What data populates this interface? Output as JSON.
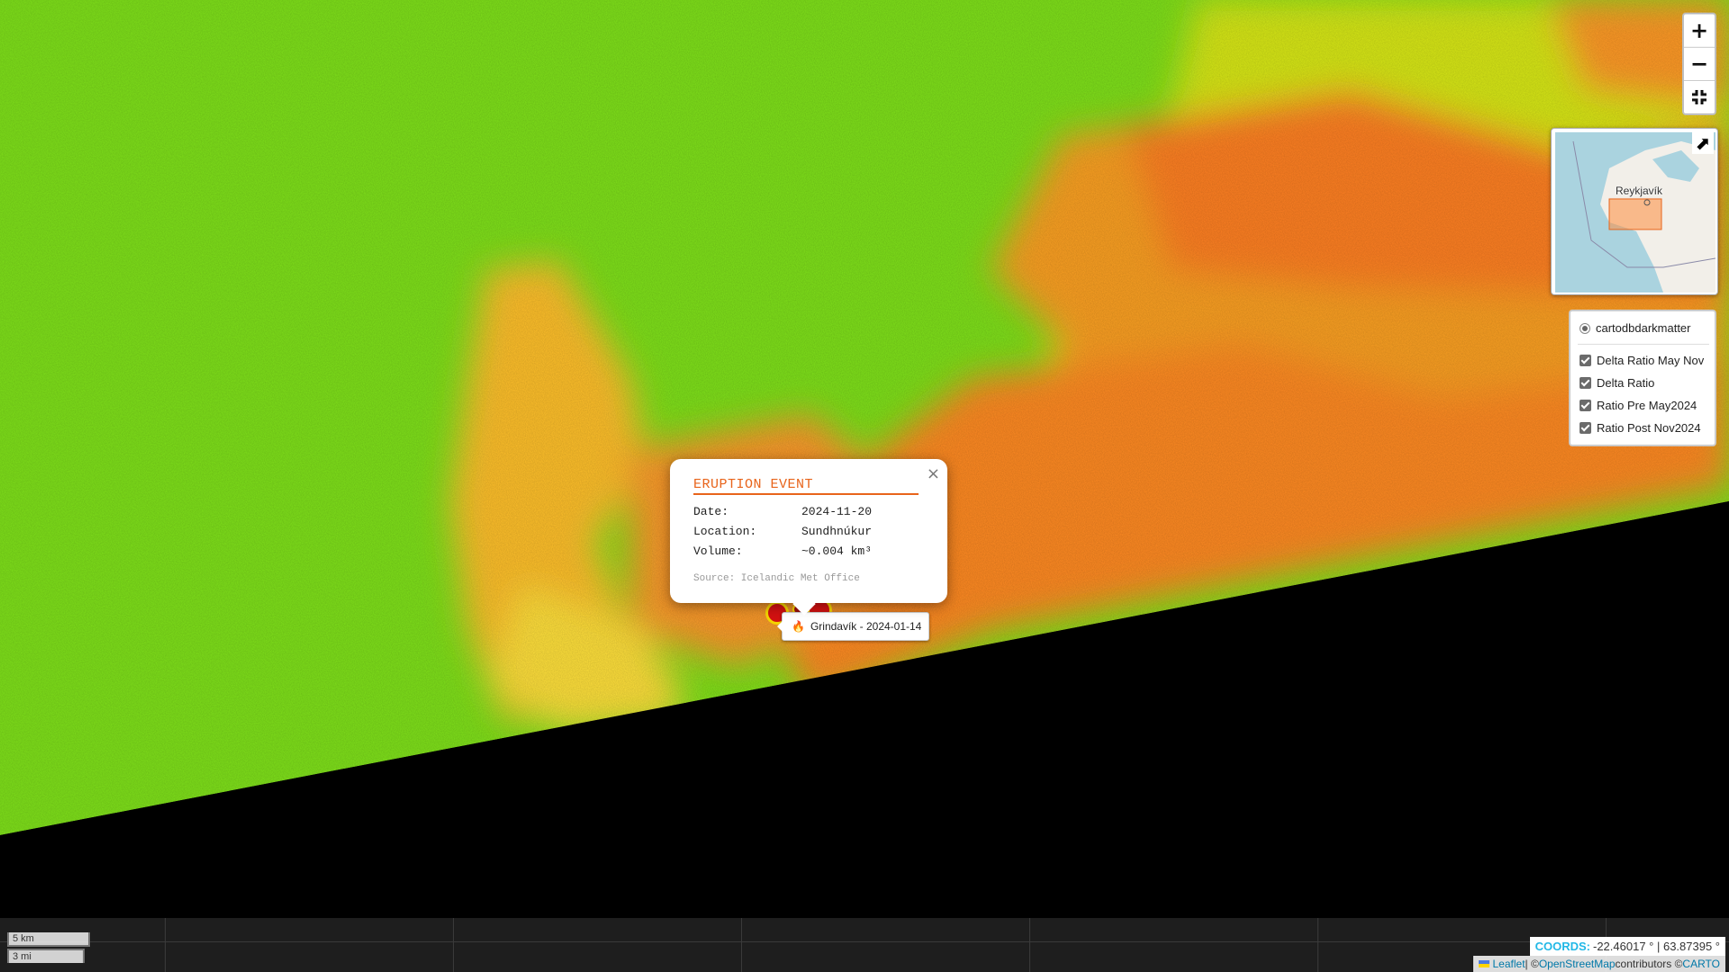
{
  "zoom": {
    "in_label": "+",
    "out_label": "−",
    "fullscreen_label": "⤡"
  },
  "minimap": {
    "city_label": "Reykjavík",
    "toggle_label": "⬈"
  },
  "layers": {
    "base": "cartodbdarkmatter",
    "overlays": [
      "Delta Ratio May Nov",
      "Delta Ratio",
      "Ratio Pre May2024",
      "Ratio Post Nov2024"
    ]
  },
  "popup": {
    "title": "ERUPTION EVENT",
    "rows": [
      {
        "key": "Date:",
        "value": "2024-11-20"
      },
      {
        "key": "Location:",
        "value": "Sundhnúkur"
      },
      {
        "key": "Volume:",
        "value": "~0.004 km³"
      }
    ],
    "source": "Source: Icelandic Met Office",
    "close_label": "×"
  },
  "tooltip": {
    "text": "Grindavík - 2024-01-14"
  },
  "scale": {
    "metric": "5 km",
    "imperial": "3 mi"
  },
  "coords": {
    "label": "COORDS:",
    "value": "-22.46017 ° | 63.87395 °"
  },
  "attribution": {
    "leaflet": "Leaflet",
    "separator": " | © ",
    "osm": "OpenStreetMap",
    "contrib": " contributors © ",
    "carto": "CARTO"
  },
  "colors": {
    "accent": "#e8641b",
    "coords_label": "#22b8e6",
    "link": "#0078a8"
  }
}
